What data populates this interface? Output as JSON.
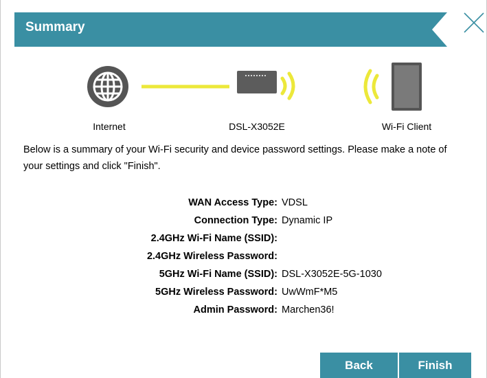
{
  "dialog": {
    "title": "Summary",
    "close_icon": "close-icon"
  },
  "diagram": {
    "internet_label": "Internet",
    "router_label": "DSL-X3052E",
    "client_label": "Wi-Fi Client"
  },
  "description": "Below is a summary of your Wi-Fi security and device password settings. Please make a note of your settings and click \"Finish\".",
  "settings": [
    {
      "label": "WAN Access Type:",
      "value": "VDSL"
    },
    {
      "label": "Connection Type:",
      "value": "Dynamic IP"
    },
    {
      "label": "2.4GHz Wi-Fi Name (SSID):",
      "value": ""
    },
    {
      "label": "2.4GHz Wireless Password:",
      "value": ""
    },
    {
      "label": "5GHz Wi-Fi Name (SSID):",
      "value": "DSL-X3052E-5G-1030"
    },
    {
      "label": "5GHz Wireless Password:",
      "value": "UwWmF*M5"
    },
    {
      "label": "Admin Password:",
      "value": "Marchen36!"
    }
  ],
  "buttons": {
    "back": "Back",
    "finish": "Finish"
  },
  "colors": {
    "banner": "#3a8fa3",
    "button": "#3a8fa3",
    "wifi_waves": "#ece83a",
    "device": "#5c5c5c"
  }
}
